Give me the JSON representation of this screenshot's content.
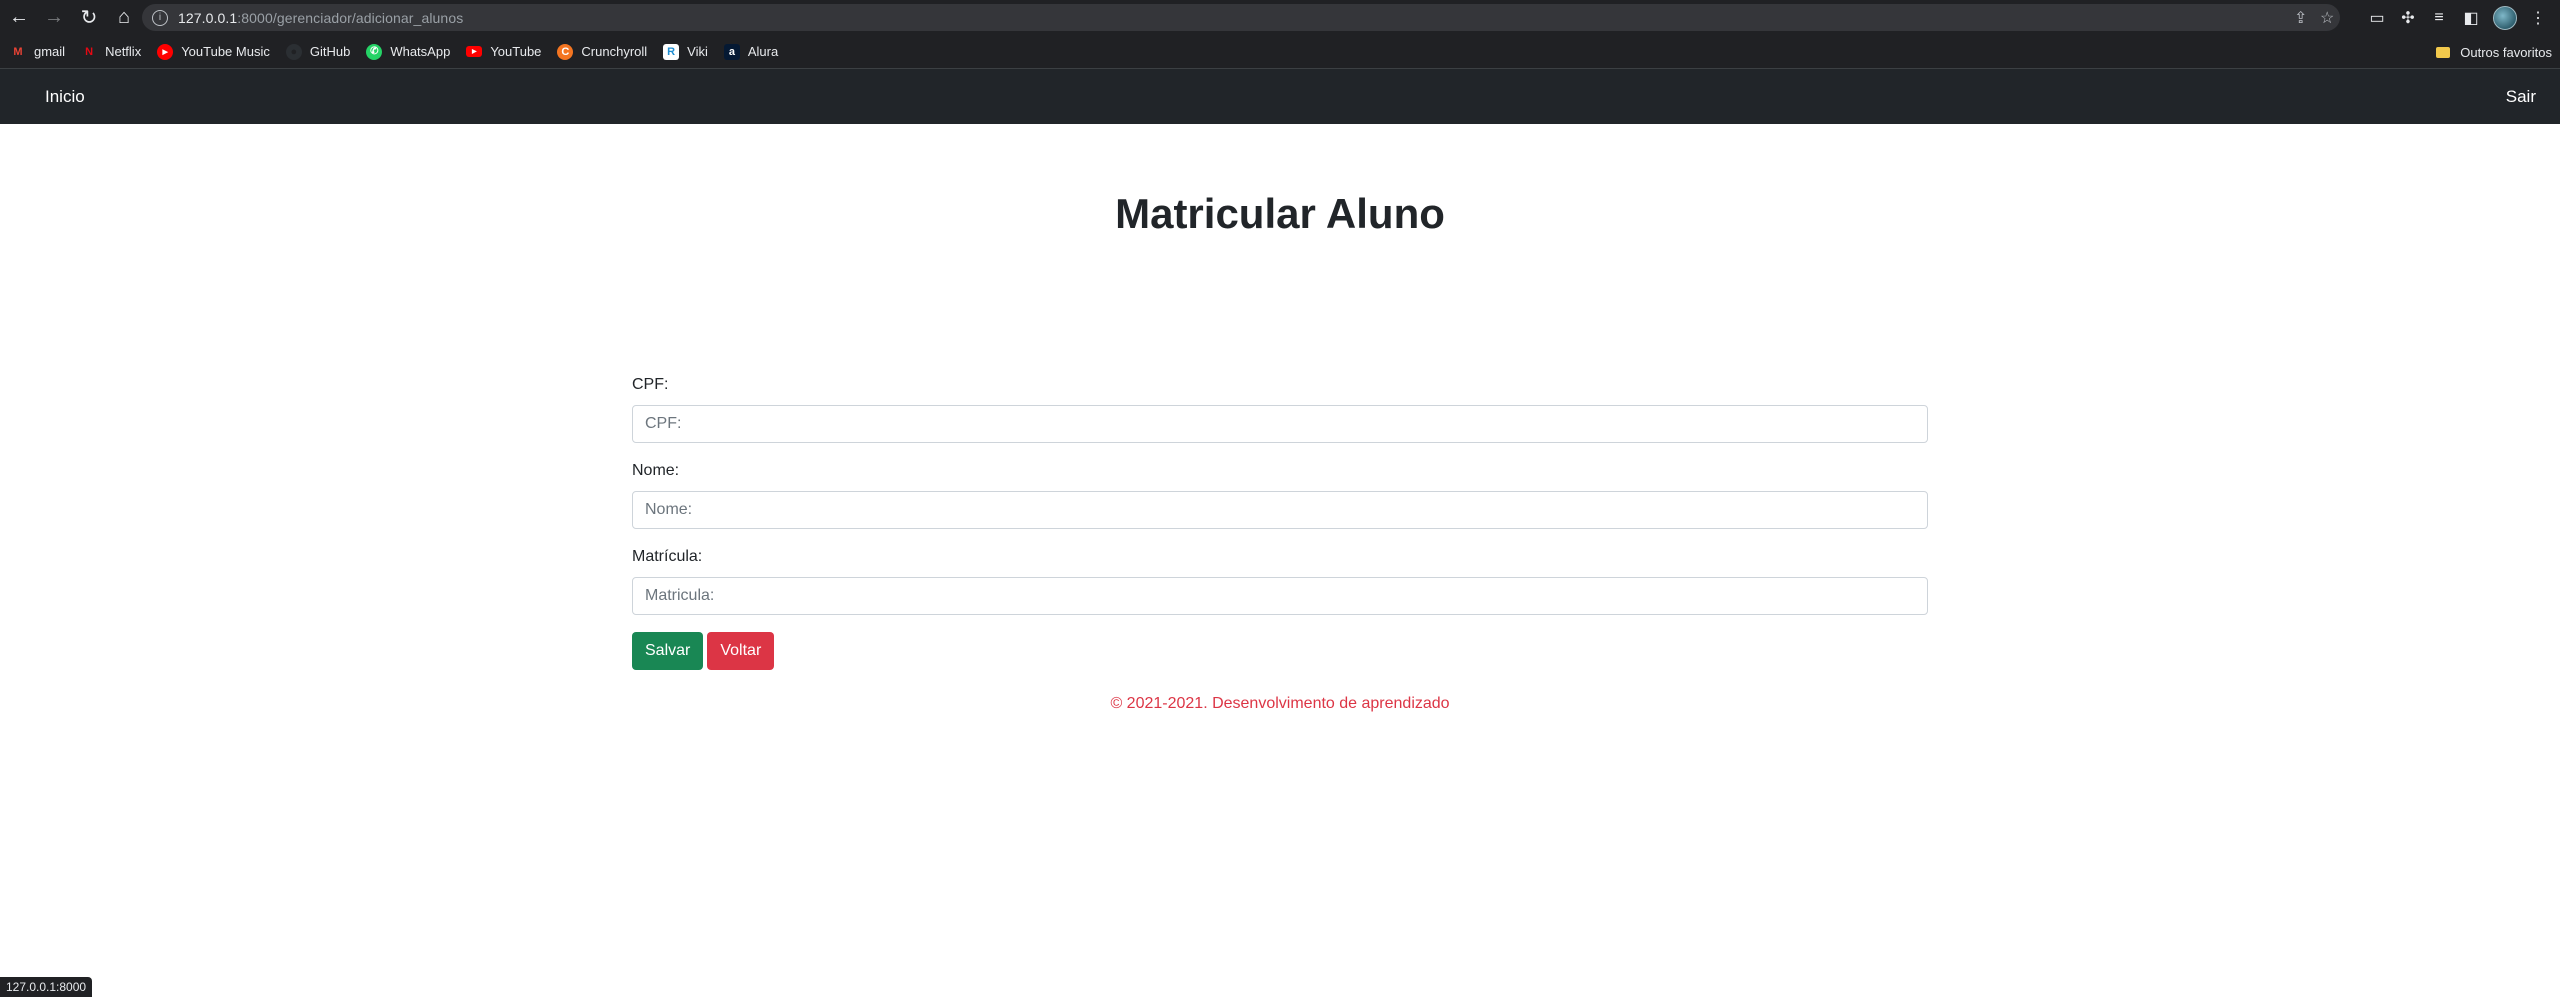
{
  "browser": {
    "url_host": "127.0.0.1",
    "url_rest": ":8000/gerenciador/adicionar_alunos",
    "bookmarks": [
      {
        "label": "gmail",
        "icon": "gmail-icon",
        "color": "#ea4335",
        "glyph": "M"
      },
      {
        "label": "Netflix",
        "icon": "netflix-icon",
        "color": "#e50914",
        "glyph": "N"
      },
      {
        "label": "YouTube Music",
        "icon": "youtube-music-icon",
        "color": "#ff0000",
        "glyph": "▶"
      },
      {
        "label": "GitHub",
        "icon": "github-icon",
        "color": "#24292e",
        "glyph": "●"
      },
      {
        "label": "WhatsApp",
        "icon": "whatsapp-icon",
        "color": "#25d366",
        "glyph": "✆"
      },
      {
        "label": "YouTube",
        "icon": "youtube-icon",
        "color": "#ff0000",
        "glyph": "▶"
      },
      {
        "label": "Crunchyroll",
        "icon": "crunchyroll-icon",
        "color": "#f47521",
        "glyph": "C"
      },
      {
        "label": "Viki",
        "icon": "viki-icon",
        "color": "#1f8ed1",
        "glyph": "R"
      },
      {
        "label": "Alura",
        "icon": "alura-icon",
        "color": "#051933",
        "glyph": "a"
      }
    ],
    "other_bookmarks": "Outros favoritos",
    "status_url": "127.0.0.1:8000"
  },
  "navbar": {
    "brand": "Inicio",
    "logout": "Sair"
  },
  "page": {
    "title": "Matricular Aluno"
  },
  "form": {
    "cpf_label": "CPF:",
    "cpf_placeholder": "CPF:",
    "nome_label": "Nome:",
    "nome_placeholder": "Nome:",
    "matricula_label": "Matrícula:",
    "matricula_placeholder": "Matricula:",
    "save_label": "Salvar",
    "back_label": "Voltar"
  },
  "footer": {
    "text": "© 2021-2021. Desenvolvimento de aprendizado"
  },
  "colors": {
    "navbar": "#212529",
    "success": "#198754",
    "danger": "#dc3545"
  }
}
